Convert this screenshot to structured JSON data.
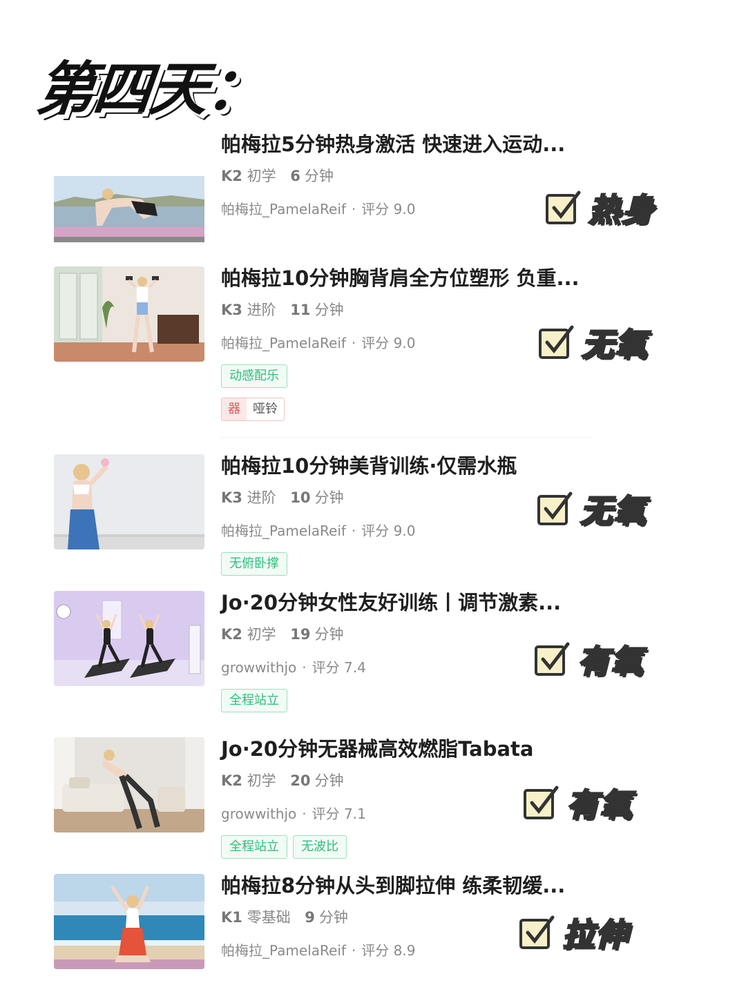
{
  "page_title": "第四天：",
  "items": [
    {
      "title": "帕梅拉5分钟热身激活 快速进入运动...",
      "level": "K2",
      "level_name": "初学",
      "duration": "6",
      "duration_unit": "分钟",
      "author": "帕梅拉_PamelaReif",
      "rating": "评分 9.0",
      "stamp": "热身",
      "tags": [],
      "equipment": null,
      "thumb_scene": "waterfront-stretch"
    },
    {
      "title": "帕梅拉10分钟胸背肩全方位塑形 负重...",
      "level": "K3",
      "level_name": "进阶",
      "duration": "11",
      "duration_unit": "分钟",
      "author": "帕梅拉_PamelaReif",
      "rating": "评分 9.0",
      "stamp": "无氧",
      "tags": [
        "动感配乐"
      ],
      "equipment": {
        "badge": "器",
        "name": "哑铃"
      },
      "thumb_scene": "indoor-dumbbell"
    },
    {
      "title": "帕梅拉10分钟美背训练·仅需水瓶",
      "level": "K3",
      "level_name": "进阶",
      "duration": "10",
      "duration_unit": "分钟",
      "author": "帕梅拉_PamelaReif",
      "rating": "评分 9.0",
      "stamp": "无氧",
      "tags": [
        "无俯卧撑"
      ],
      "equipment": null,
      "thumb_scene": "back-view-wall"
    },
    {
      "title": "Jo·20分钟女性友好训练丨调节激素...",
      "level": "K2",
      "level_name": "初学",
      "duration": "19",
      "duration_unit": "分钟",
      "author": "growwithjo",
      "rating": "评分 7.4",
      "stamp": "有氧",
      "tags": [
        "全程站立"
      ],
      "equipment": null,
      "thumb_scene": "purple-room-duo"
    },
    {
      "title": "Jo·20分钟无器械高效燃脂Tabata",
      "level": "K2",
      "level_name": "初学",
      "duration": "20",
      "duration_unit": "分钟",
      "author": "growwithjo",
      "rating": "评分 7.1",
      "stamp": "有氧",
      "tags": [
        "全程站立",
        "无波比"
      ],
      "equipment": null,
      "thumb_scene": "living-room-lunge"
    },
    {
      "title": "帕梅拉8分钟从头到脚拉伸 练柔韧缓...",
      "level": "K1",
      "level_name": "零基础",
      "duration": "9",
      "duration_unit": "分钟",
      "author": "帕梅拉_PamelaReif",
      "rating": "评分 8.9",
      "stamp": "拉伸",
      "tags": [],
      "equipment": null,
      "thumb_scene": "beach-kneel"
    }
  ],
  "colors": {
    "tag_green": "#2bbf7a",
    "equip_red": "#e0585a",
    "title": "#1f1f1f",
    "meta": "#888888"
  }
}
